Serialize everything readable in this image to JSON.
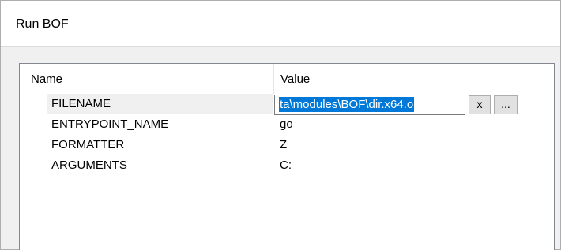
{
  "dialog": {
    "title": "Run BOF"
  },
  "grid": {
    "columns": {
      "name": "Name",
      "value": "Value"
    },
    "rows": [
      {
        "name": "FILENAME",
        "value": "ta\\modules\\BOF\\dir.x64.o"
      },
      {
        "name": "ENTRYPOINT_NAME",
        "value": "go"
      },
      {
        "name": "FORMATTER",
        "value": "Z"
      },
      {
        "name": "ARGUMENTS",
        "value": "C:"
      }
    ],
    "buttons": {
      "clear": "x",
      "browse": "..."
    }
  }
}
